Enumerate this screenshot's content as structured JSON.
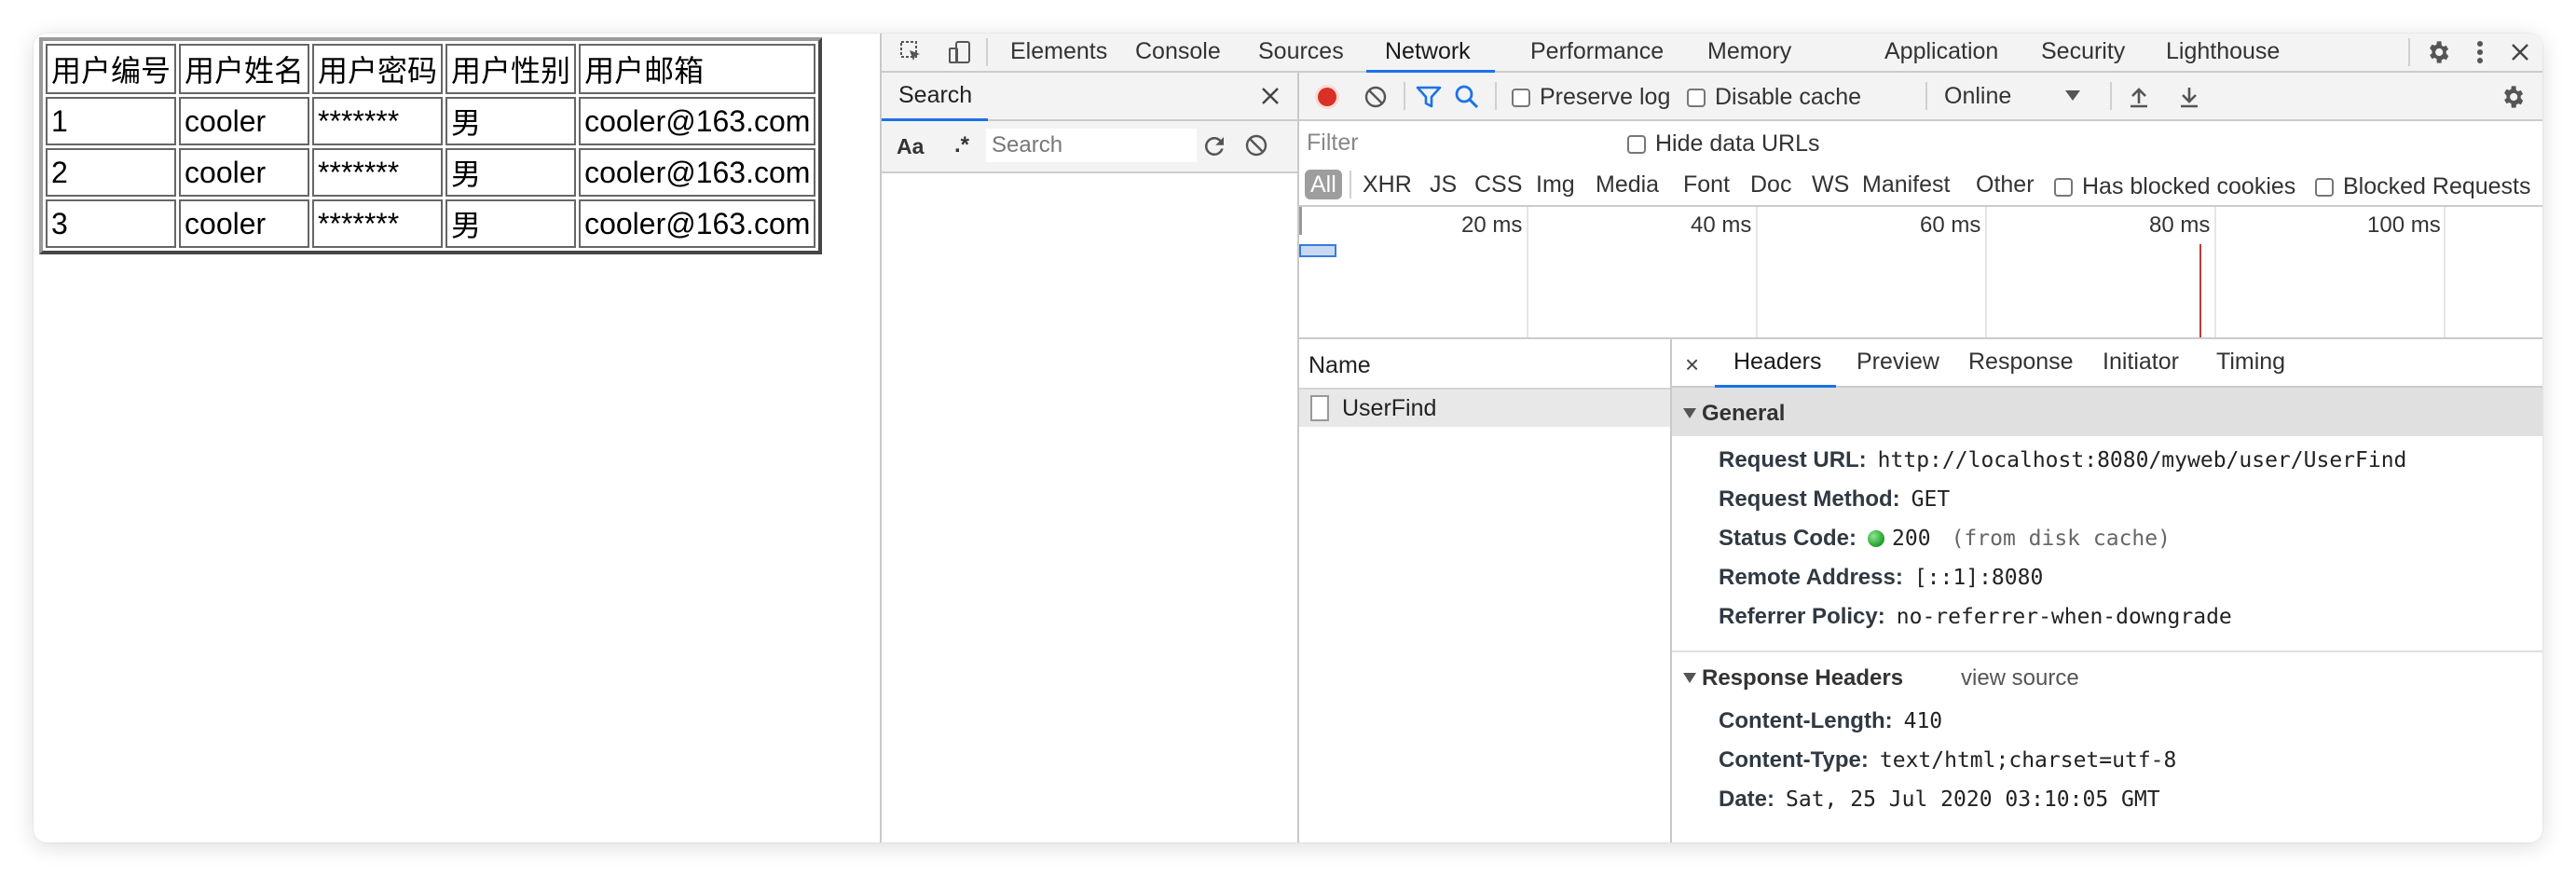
{
  "page": {
    "table": {
      "headers": [
        "用户编号",
        "用户姓名",
        "用户密码",
        "用户性别",
        "用户邮箱"
      ],
      "rows": [
        [
          "1",
          "cooler",
          "*******",
          "男",
          "cooler@163.com"
        ],
        [
          "2",
          "cooler",
          "*******",
          "男",
          "cooler@163.com"
        ],
        [
          "3",
          "cooler",
          "*******",
          "男",
          "cooler@163.com"
        ]
      ]
    }
  },
  "devtools": {
    "tabs": [
      "Elements",
      "Console",
      "Sources",
      "Network",
      "Performance",
      "Memory",
      "Application",
      "Security",
      "Lighthouse"
    ],
    "active_tab": "Network",
    "search": {
      "title": "Search",
      "case_label": "Aa",
      "regex_label": ".*",
      "placeholder": "Search"
    },
    "network": {
      "preserve_log": "Preserve log",
      "disable_cache": "Disable cache",
      "throttling": "Online",
      "filter_placeholder": "Filter",
      "hide_data_urls": "Hide data URLs",
      "types": [
        "All",
        "XHR",
        "JS",
        "CSS",
        "Img",
        "Media",
        "Font",
        "Doc",
        "WS",
        "Manifest",
        "Other"
      ],
      "has_blocked_cookies": "Has blocked cookies",
      "blocked_requests": "Blocked Requests",
      "timeline_ticks": [
        "20 ms",
        "40 ms",
        "60 ms",
        "80 ms",
        "100 ms"
      ],
      "name_header": "Name",
      "requests": [
        "UserFind"
      ]
    },
    "details": {
      "close": "×",
      "tabs": [
        "Headers",
        "Preview",
        "Response",
        "Initiator",
        "Timing"
      ],
      "active_tab": "Headers",
      "general": {
        "title": "General",
        "request_url_k": "Request URL:",
        "request_url_v": "http://localhost:8080/myweb/user/UserFind",
        "method_k": "Request Method:",
        "method_v": "GET",
        "status_k": "Status Code:",
        "status_v": "200",
        "status_note": "(from disk cache)",
        "remote_k": "Remote Address:",
        "remote_v": "[::1]:8080",
        "referrer_k": "Referrer Policy:",
        "referrer_v": "no-referrer-when-downgrade"
      },
      "response_headers": {
        "title": "Response Headers",
        "view_source": "view source",
        "content_length_k": "Content-Length:",
        "content_length_v": "410",
        "content_type_k": "Content-Type:",
        "content_type_v": "text/html;charset=utf-8",
        "date_k": "Date:",
        "date_v": "Sat, 25 Jul 2020 03:10:05 GMT"
      }
    },
    "colors": {
      "accent": "#1a73e8",
      "record": "#d93025",
      "status_ok": "#1e9e2a"
    }
  }
}
